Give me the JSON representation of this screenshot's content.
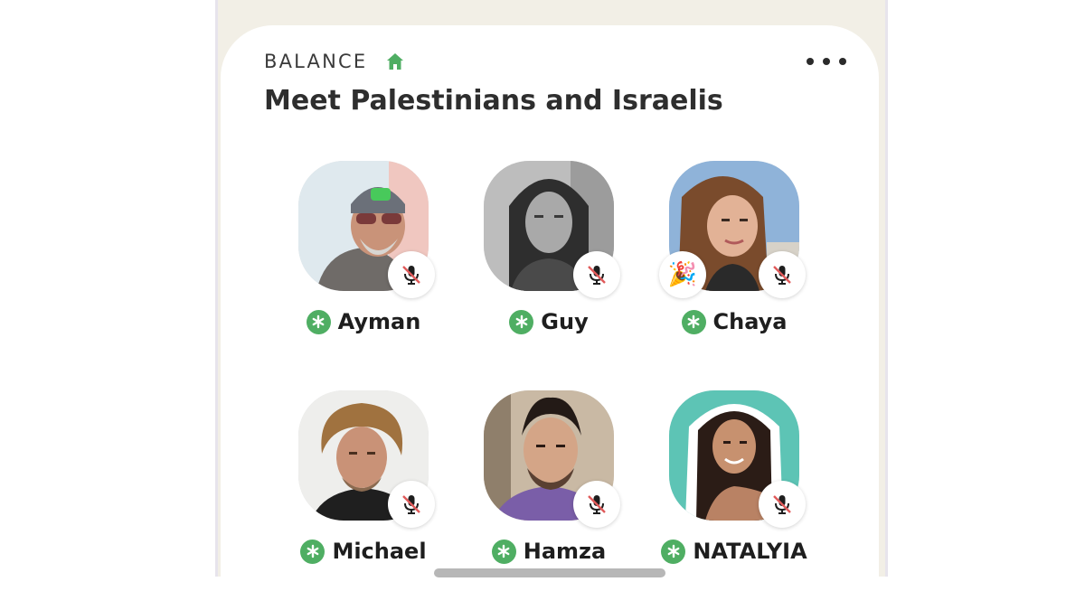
{
  "club": {
    "name": "BALANCE",
    "icon": "house-icon",
    "accent_color": "#4fae63"
  },
  "room": {
    "title": "Meet Palestinians and Israelis"
  },
  "speakers": [
    {
      "name": "Ayman",
      "muted": true,
      "moderator": true,
      "badge": null
    },
    {
      "name": "Guy",
      "muted": true,
      "moderator": true,
      "badge": null
    },
    {
      "name": "Chaya",
      "muted": true,
      "moderator": true,
      "badge": "party-popper"
    },
    {
      "name": "Michael",
      "muted": true,
      "moderator": true,
      "badge": null
    },
    {
      "name": "Hamza",
      "muted": true,
      "moderator": true,
      "badge": null
    },
    {
      "name": "NATALYIA",
      "muted": true,
      "moderator": true,
      "badge": null
    }
  ]
}
